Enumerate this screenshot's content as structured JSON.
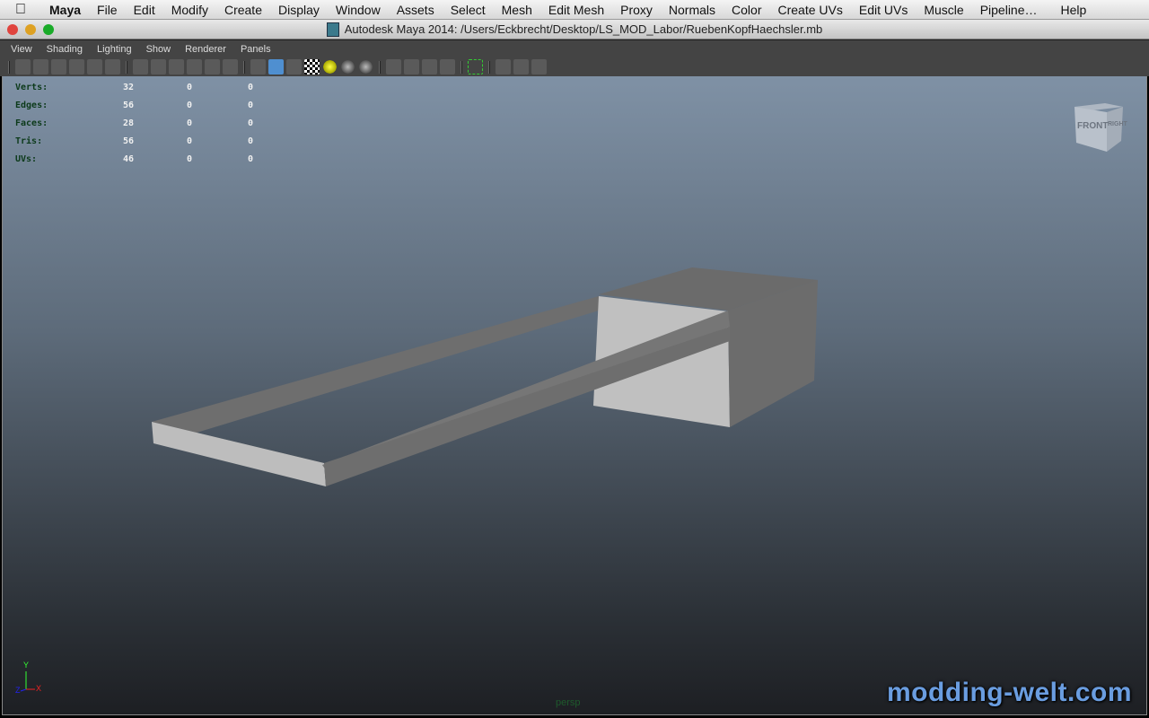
{
  "menubar": {
    "apple": "",
    "items": [
      "Maya",
      "File",
      "Edit",
      "Modify",
      "Create",
      "Display",
      "Window",
      "Assets",
      "Select",
      "Mesh",
      "Edit Mesh",
      "Proxy",
      "Normals",
      "Color",
      "Create UVs",
      "Edit UVs",
      "Muscle",
      "Pipeline…",
      "Help"
    ]
  },
  "window": {
    "title": "Autodesk Maya 2014: /Users/Eckbrecht/Desktop/LS_MOD_Labor/RuebenKopfHaechsler.mb",
    "traffic_colors": [
      "#e0443e",
      "#dea123",
      "#1aab29"
    ]
  },
  "panel_menu": [
    "View",
    "Shading",
    "Lighting",
    "Show",
    "Renderer",
    "Panels"
  ],
  "toolbar": {
    "groups": [
      [
        "camera-attributes-icon",
        "camera-tools-icon",
        "bookmarks-icon",
        "image-plane-icon",
        "2d-pan-zoom-icon",
        "grease-pencil-icon"
      ],
      [
        "grid-icon",
        "film-gate-icon",
        "resolution-gate-icon",
        "gate-mask-icon",
        "field-chart-icon",
        "safe-action-icon"
      ],
      [
        "wireframe-icon",
        "smooth-shade-icon",
        "wireframe-on-shaded-icon",
        "textured-icon",
        "default-lights-icon",
        "shadows-icon",
        "screen-space-ao-icon"
      ],
      [
        "motion-blur-icon",
        "anti-aliasing-icon",
        "depth-of-field-icon",
        "xray-icon"
      ],
      [
        "isolate-select-icon"
      ],
      [
        "xray-joints-icon",
        "xray-active-icon",
        "symmetry-icon"
      ]
    ]
  },
  "hud": {
    "rows": [
      {
        "label": "Verts:",
        "values": [
          "32",
          "0",
          "0"
        ]
      },
      {
        "label": "Edges:",
        "values": [
          "56",
          "0",
          "0"
        ]
      },
      {
        "label": "Faces:",
        "values": [
          "28",
          "0",
          "0"
        ]
      },
      {
        "label": "Tris:",
        "values": [
          "56",
          "0",
          "0"
        ]
      },
      {
        "label": "UVs:",
        "values": [
          "46",
          "0",
          "0"
        ]
      }
    ]
  },
  "viewcube": {
    "front": "FRONT",
    "right": "RIGHT"
  },
  "axis": {
    "y": "Y",
    "x": "X",
    "z": "Z"
  },
  "camera_label": "persp",
  "watermark": "modding-welt.com"
}
